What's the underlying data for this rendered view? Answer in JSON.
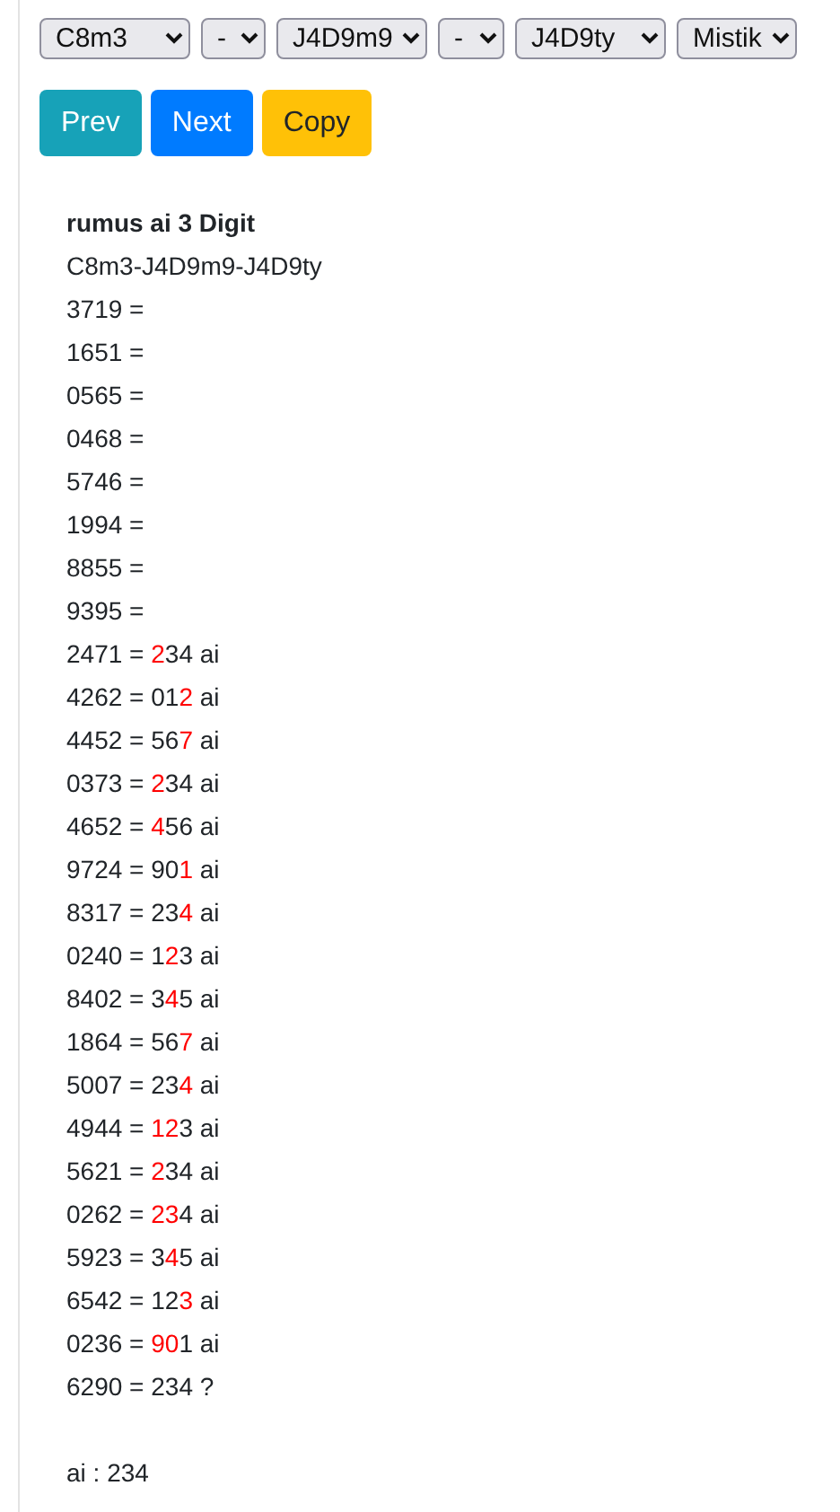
{
  "selects": [
    {
      "value": "C8m3"
    },
    {
      "value": "-"
    },
    {
      "value": "J4D9m9"
    },
    {
      "value": "-"
    },
    {
      "value": "J4D9ty"
    },
    {
      "value": "Mistik"
    }
  ],
  "buttons": [
    {
      "label": "Prev",
      "kind": "info"
    },
    {
      "label": "Next",
      "kind": "primary"
    },
    {
      "label": "Copy",
      "kind": "warning"
    }
  ],
  "title": "rumus ai 3 Digit",
  "formula": "C8m3-J4D9m9-J4D9ty",
  "rows": [
    {
      "lead": "3719 ="
    },
    {
      "lead": "1651 ="
    },
    {
      "lead": "0565 ="
    },
    {
      "lead": "0468 ="
    },
    {
      "lead": "5746 ="
    },
    {
      "lead": "1994 ="
    },
    {
      "lead": "8855 ="
    },
    {
      "lead": "9395 ="
    },
    {
      "lead": "2471 =",
      "digits": [
        {
          "d": "2",
          "hit": true
        },
        {
          "d": "3",
          "hit": false
        },
        {
          "d": "4",
          "hit": false
        }
      ],
      "tail": "ai"
    },
    {
      "lead": "4262 =",
      "digits": [
        {
          "d": "0",
          "hit": false
        },
        {
          "d": "1",
          "hit": false
        },
        {
          "d": "2",
          "hit": true
        }
      ],
      "tail": "ai"
    },
    {
      "lead": "4452 =",
      "digits": [
        {
          "d": "5",
          "hit": false
        },
        {
          "d": "6",
          "hit": false
        },
        {
          "d": "7",
          "hit": true
        }
      ],
      "tail": "ai"
    },
    {
      "lead": "0373 =",
      "digits": [
        {
          "d": "2",
          "hit": true
        },
        {
          "d": "3",
          "hit": false
        },
        {
          "d": "4",
          "hit": false
        }
      ],
      "tail": "ai"
    },
    {
      "lead": "4652 =",
      "digits": [
        {
          "d": "4",
          "hit": true
        },
        {
          "d": "5",
          "hit": false
        },
        {
          "d": "6",
          "hit": false
        }
      ],
      "tail": "ai"
    },
    {
      "lead": "9724 =",
      "digits": [
        {
          "d": "9",
          "hit": false
        },
        {
          "d": "0",
          "hit": false
        },
        {
          "d": "1",
          "hit": true
        }
      ],
      "tail": "ai"
    },
    {
      "lead": "8317 =",
      "digits": [
        {
          "d": "2",
          "hit": false
        },
        {
          "d": "3",
          "hit": false
        },
        {
          "d": "4",
          "hit": true
        }
      ],
      "tail": "ai"
    },
    {
      "lead": "0240 =",
      "digits": [
        {
          "d": "1",
          "hit": false
        },
        {
          "d": "2",
          "hit": true
        },
        {
          "d": "3",
          "hit": false
        }
      ],
      "tail": "ai"
    },
    {
      "lead": "8402 =",
      "digits": [
        {
          "d": "3",
          "hit": false
        },
        {
          "d": "4",
          "hit": true
        },
        {
          "d": "5",
          "hit": false
        }
      ],
      "tail": "ai"
    },
    {
      "lead": "1864 =",
      "digits": [
        {
          "d": "5",
          "hit": false
        },
        {
          "d": "6",
          "hit": false
        },
        {
          "d": "7",
          "hit": true
        }
      ],
      "tail": "ai"
    },
    {
      "lead": "5007 =",
      "digits": [
        {
          "d": "2",
          "hit": false
        },
        {
          "d": "3",
          "hit": false
        },
        {
          "d": "4",
          "hit": true
        }
      ],
      "tail": "ai"
    },
    {
      "lead": "4944 =",
      "digits": [
        {
          "d": "1",
          "hit": true
        },
        {
          "d": "2",
          "hit": true
        },
        {
          "d": "3",
          "hit": false
        }
      ],
      "tail": "ai"
    },
    {
      "lead": "5621 =",
      "digits": [
        {
          "d": "2",
          "hit": true
        },
        {
          "d": "3",
          "hit": false
        },
        {
          "d": "4",
          "hit": false
        }
      ],
      "tail": "ai"
    },
    {
      "lead": "0262 =",
      "digits": [
        {
          "d": "2",
          "hit": true
        },
        {
          "d": "3",
          "hit": true
        },
        {
          "d": "4",
          "hit": false
        }
      ],
      "tail": "ai"
    },
    {
      "lead": "5923 =",
      "digits": [
        {
          "d": "3",
          "hit": false
        },
        {
          "d": "4",
          "hit": true
        },
        {
          "d": "5",
          "hit": false
        }
      ],
      "tail": "ai"
    },
    {
      "lead": "6542 =",
      "digits": [
        {
          "d": "1",
          "hit": false
        },
        {
          "d": "2",
          "hit": false
        },
        {
          "d": "3",
          "hit": true
        }
      ],
      "tail": "ai"
    },
    {
      "lead": "0236 =",
      "digits": [
        {
          "d": "9",
          "hit": true
        },
        {
          "d": "0",
          "hit": true
        },
        {
          "d": "1",
          "hit": false
        }
      ],
      "tail": "ai"
    },
    {
      "lead": "6290 =",
      "digits": [
        {
          "d": "2",
          "hit": false
        },
        {
          "d": "3",
          "hit": false
        },
        {
          "d": "4",
          "hit": false
        }
      ],
      "tail": "?"
    }
  ],
  "result": "ai : 234"
}
